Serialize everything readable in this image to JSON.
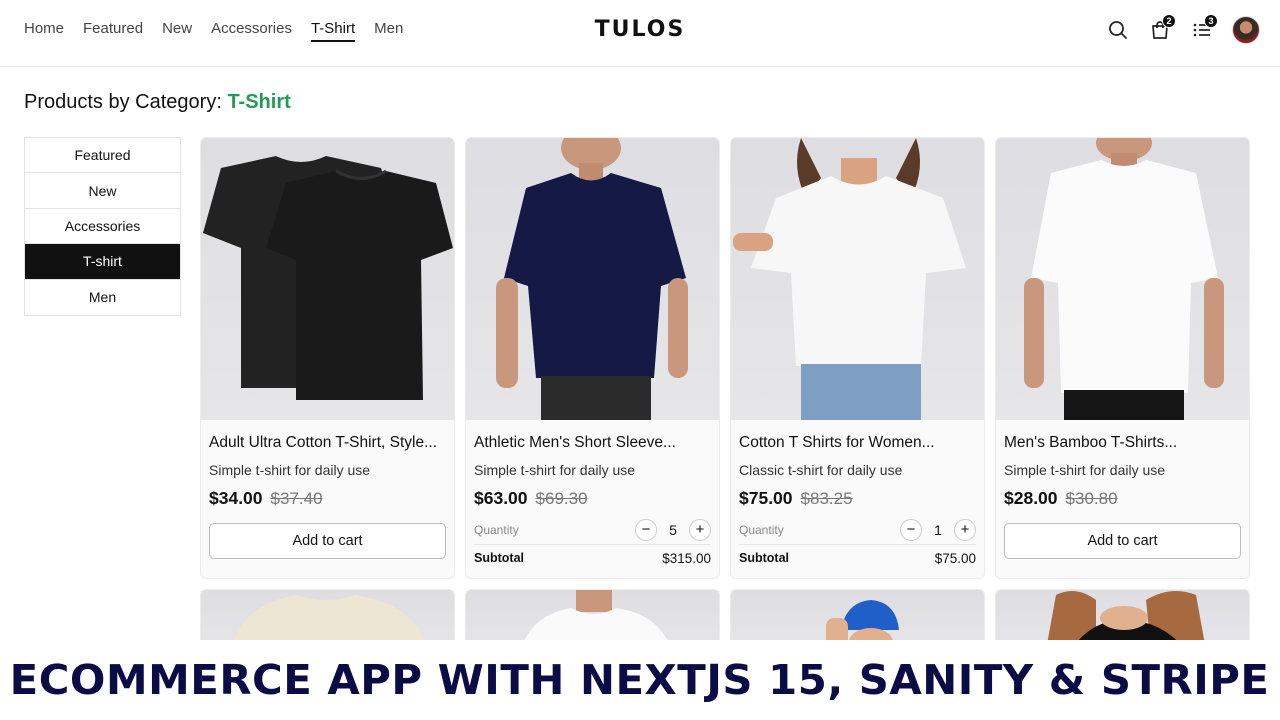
{
  "nav": {
    "items": [
      {
        "label": "Home",
        "active": false
      },
      {
        "label": "Featured",
        "active": false
      },
      {
        "label": "New",
        "active": false
      },
      {
        "label": "Accessories",
        "active": false
      },
      {
        "label": "T-Shirt",
        "active": true
      },
      {
        "label": "Men",
        "active": false
      }
    ]
  },
  "brand": {
    "logo": "TULOS"
  },
  "header_icons": {
    "search": "search-icon",
    "cart": {
      "icon": "shopping-bag-icon",
      "badge": "2"
    },
    "orders": {
      "icon": "list-icon",
      "badge": "3"
    },
    "avatar": "user-avatar"
  },
  "page": {
    "title_prefix": "Products by Category:",
    "category": "T-Shirt"
  },
  "sidebar": {
    "items": [
      {
        "label": "Featured",
        "active": false
      },
      {
        "label": "New",
        "active": false
      },
      {
        "label": "Accessories",
        "active": false
      },
      {
        "label": "T-shirt",
        "active": true
      },
      {
        "label": "Men",
        "active": false
      }
    ]
  },
  "products": [
    {
      "title": "Adult Ultra Cotton T-Shirt, Style...",
      "description": "Simple t-shirt for daily use",
      "price": "$34.00",
      "old_price": "$37.40",
      "in_cart": false,
      "button": "Add to cart"
    },
    {
      "title": "Athletic Men's Short Sleeve...",
      "description": "Simple t-shirt for daily use",
      "price": "$63.00",
      "old_price": "$69.30",
      "in_cart": true,
      "quantity_label": "Quantity",
      "quantity": "5",
      "subtotal_label": "Subtotal",
      "subtotal": "$315.00"
    },
    {
      "title": "Cotton T Shirts for Women...",
      "description": "Classic t-shirt for daily use",
      "price": "$75.00",
      "old_price": "$83.25",
      "in_cart": true,
      "quantity_label": "Quantity",
      "quantity": "1",
      "subtotal_label": "Subtotal",
      "subtotal": "$75.00"
    },
    {
      "title": "Men's Bamboo T-Shirts...",
      "description": "Simple t-shirt for daily use",
      "price": "$28.00",
      "old_price": "$30.80",
      "in_cart": false,
      "button": "Add to cart"
    }
  ],
  "banner": {
    "text": "ECOMMERCE APP WITH NEXTJS 15, SANITY & STRIPE",
    "color": "#0b0b46"
  },
  "colors": {
    "accent": "#1f9d55",
    "active_bg": "#111111"
  }
}
